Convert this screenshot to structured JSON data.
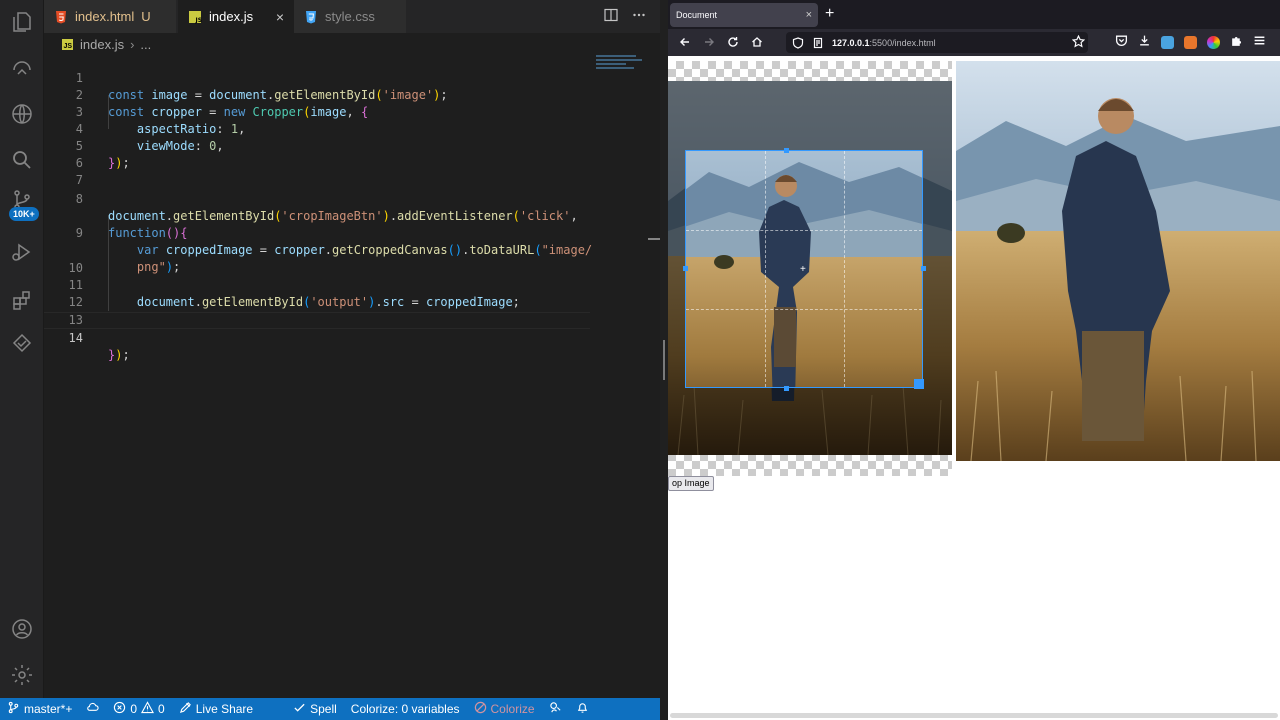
{
  "editor": {
    "tabs": [
      {
        "label": "index.html",
        "flag": "U"
      },
      {
        "label": "index.js",
        "close": "×"
      },
      {
        "label": "style.css"
      }
    ],
    "breadcrumb": {
      "file": "index.js",
      "rest": "..."
    },
    "activity_badge": "10K+",
    "line_numbers": [
      "1",
      "2",
      "3",
      "4",
      "5",
      "6",
      "7",
      "8",
      "",
      "9",
      "",
      "10",
      "11",
      "12",
      "13",
      "14"
    ]
  },
  "statusbar": {
    "branch": "master*+",
    "errors": "0",
    "warnings": "0",
    "live_share": "Live Share",
    "spell": "Spell",
    "colorize_vars": "Colorize: 0 variables",
    "colorize": "Colorize"
  },
  "browser": {
    "tab_title": "Document",
    "tab_close": "×",
    "new_tab": "+",
    "url_host": "127.0.0.1",
    "url_path": ":5500/index.html",
    "crop_button": "op Image"
  },
  "colors": {
    "statusbar": "#0e70c0",
    "crop_accent": "#3399ff"
  }
}
